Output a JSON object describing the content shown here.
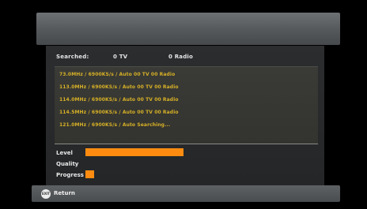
{
  "searched": {
    "label": "Searched:",
    "tv_count": "0 TV",
    "radio_count": "0 Radio"
  },
  "results": [
    "73.0MHz / 6900KS/s / Auto   00 TV  00 Radio",
    "113.0MHz / 6900KS/s / Auto   00 TV  00 Radio",
    "114.0MHz / 6900KS/s / Auto   00 TV  00 Radio",
    "114.5MHz / 6900KS/s / Auto   00 TV  00 Radio",
    "121.0MHz / 6900KS/s / Auto Searching..."
  ],
  "meters": {
    "level": {
      "label": "Level",
      "value": 0.69
    },
    "quality": {
      "label": "Quality",
      "value": 0
    },
    "progress": {
      "label": "Progress",
      "value": 0.06
    }
  },
  "footer": {
    "exit_icon_text": "EXIT",
    "return_label": "Return"
  },
  "colors": {
    "bar": "#ff8c10",
    "result_text": "#d7b126"
  }
}
